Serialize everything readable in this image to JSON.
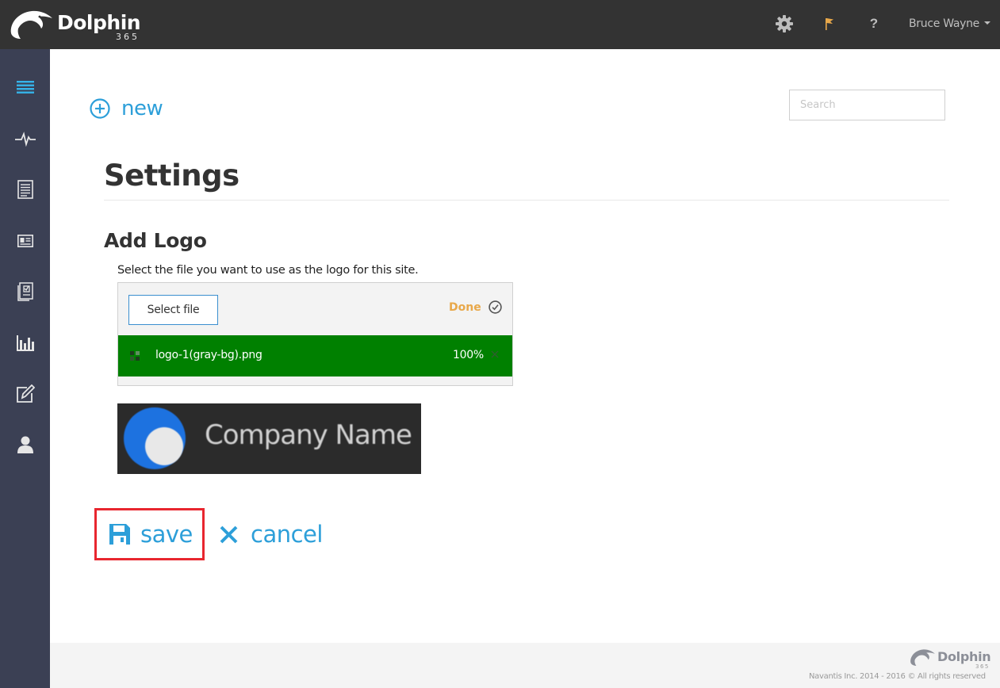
{
  "app": {
    "brand_name": "Dolphin",
    "brand_sub": "365"
  },
  "header": {
    "user_name": "Bruce Wayne",
    "help_label": "?",
    "icons": [
      "gear-icon",
      "flag-icon",
      "help-icon",
      "chevron-down-icon"
    ],
    "colors": {
      "bar": "#333333",
      "flag": "#e8a84a",
      "icon": "#bdbdbd"
    }
  },
  "sidebar": {
    "items": [
      {
        "icon": "menu-icon",
        "active": true
      },
      {
        "icon": "activity-icon"
      },
      {
        "icon": "document-icon"
      },
      {
        "icon": "id-card-icon"
      },
      {
        "icon": "checklist-icon"
      },
      {
        "icon": "bar-chart-icon"
      },
      {
        "icon": "edit-icon"
      },
      {
        "icon": "user-icon"
      }
    ],
    "colors": {
      "background": "#3b4054",
      "active_icon": "#35b4ea",
      "icon": "#e6e6e6"
    }
  },
  "toolbar": {
    "new_label": "new",
    "search_placeholder": "Search"
  },
  "page": {
    "title": "Settings"
  },
  "logo_section": {
    "title": "Add Logo",
    "description": "Select the file you want to use as the logo for this site.",
    "select_file_label": "Select file",
    "status_label": "Done",
    "file": {
      "name": "logo-1(gray-bg).png",
      "progress_label": "100%",
      "progress": 100
    },
    "preview": {
      "company_text": "Company Name"
    }
  },
  "actions": {
    "save_label": "save",
    "cancel_label": "cancel"
  },
  "footer": {
    "logo_name": "Dolphin",
    "logo_sub": "365",
    "copyright": "Navantis Inc. 2014 - 2016 © All rights reserved"
  },
  "colors": {
    "accent": "#2d9fd9",
    "success": "#008000",
    "highlight_border": "#e8262f",
    "done_status": "#e8a84a"
  }
}
